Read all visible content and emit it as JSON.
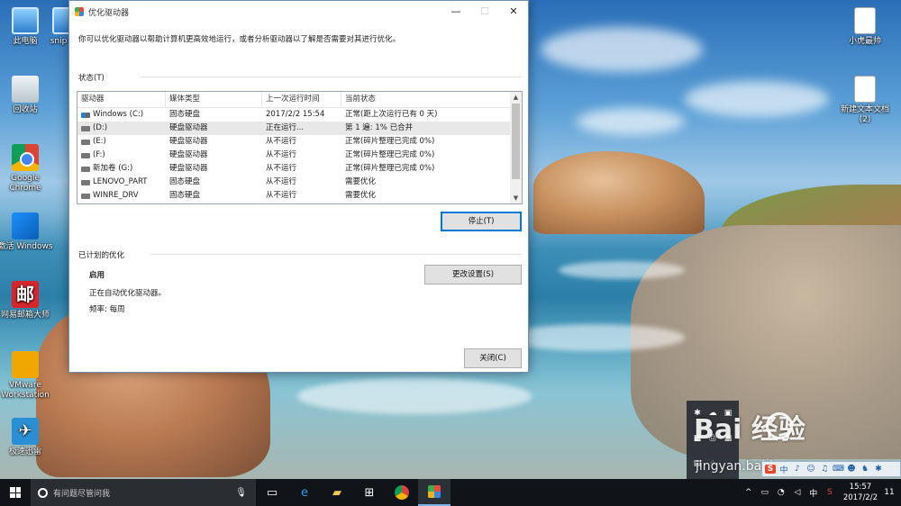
{
  "desktop": {
    "icons": [
      {
        "label": "此电脑",
        "icon": "computer-icon"
      },
      {
        "label": "回收站",
        "icon": "recycle-bin-icon"
      },
      {
        "label": "Google Chrome",
        "icon": "chrome-icon"
      },
      {
        "label": "激活 Windows",
        "icon": "windows-activate-icon"
      },
      {
        "label": "网易邮箱大师",
        "icon": "netease-mail-icon"
      },
      {
        "label": "VMware Workstation",
        "icon": "vmware-icon"
      },
      {
        "label": "极速迅雷",
        "icon": "xunlei-icon"
      },
      {
        "label": "snip",
        "icon": "snipping-icon"
      },
      {
        "label": "小虎最帅",
        "icon": "text-file-icon"
      },
      {
        "label": "新建文本文档 (2)",
        "icon": "text-file-icon"
      }
    ]
  },
  "window": {
    "title": "优化驱动器",
    "description": "你可以优化驱动器以帮助计算机更高效地运行，或者分析驱动器以了解是否需要对其进行优化。",
    "status_label": "状态(T)",
    "columns": [
      "驱动器",
      "媒体类型",
      "上一次运行时间",
      "当前状态"
    ],
    "drives": [
      {
        "name": "Windows (C:)",
        "media": "固态硬盘",
        "last_run": "2017/2/2 15:54",
        "status": "正常(距上次运行已有 0 天)",
        "icon": "system-drive-icon",
        "selected": false
      },
      {
        "name": "(D:)",
        "media": "硬盘驱动器",
        "last_run": "正在运行...",
        "status": "第 1 遍: 1% 已合并",
        "icon": "hard-drive-icon",
        "selected": true
      },
      {
        "name": "(E:)",
        "media": "硬盘驱动器",
        "last_run": "从不运行",
        "status": "正常(碎片整理已完成 0%)",
        "icon": "hard-drive-icon",
        "selected": false
      },
      {
        "name": "(F:)",
        "media": "硬盘驱动器",
        "last_run": "从不运行",
        "status": "正常(碎片整理已完成 0%)",
        "icon": "hard-drive-icon",
        "selected": false
      },
      {
        "name": "新加卷 (G:)",
        "media": "硬盘驱动器",
        "last_run": "从不运行",
        "status": "正常(碎片整理已完成 0%)",
        "icon": "hard-drive-icon",
        "selected": false
      },
      {
        "name": "LENOVO_PART",
        "media": "固态硬盘",
        "last_run": "从不运行",
        "status": "需要优化",
        "icon": "hard-drive-icon",
        "selected": false
      },
      {
        "name": "WINRE_DRV",
        "media": "固态硬盘",
        "last_run": "从不运行",
        "status": "需要优化",
        "icon": "hard-drive-icon",
        "selected": false
      }
    ],
    "stop_button": "停止(T)",
    "scheduled_label": "已计划的优化",
    "scheduled_state": "启用",
    "scheduled_desc": "正在自动优化驱动器。",
    "scheduled_freq": "频率: 每周",
    "change_settings_button": "更改设置(S)",
    "close_button": "关闭(C)"
  },
  "taskbar": {
    "search_placeholder": "有问题尽管问我",
    "apps": [
      "task-view-icon",
      "edge-icon",
      "file-explorer-icon",
      "store-icon",
      "chrome-icon",
      "defrag-icon"
    ],
    "ime": "中",
    "time": "15:57",
    "date": "2017/2/2",
    "notification_count": "11"
  },
  "watermark": {
    "brand": "Bai 经验",
    "site": "jingyan.baidu.com"
  },
  "colors": {
    "accent": "#0078d7",
    "selection": "#e8e8e8",
    "taskbar": "#101418"
  }
}
